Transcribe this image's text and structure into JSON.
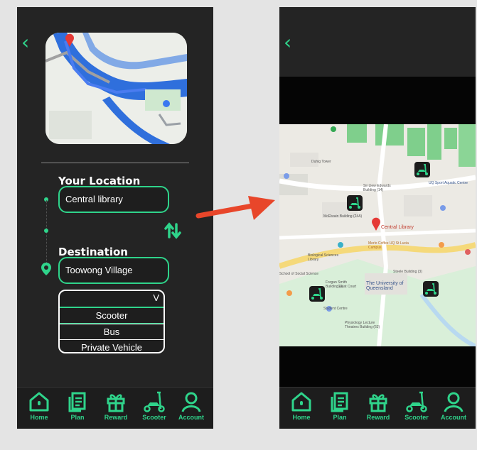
{
  "left_screen": {
    "back_icon": "‹",
    "form": {
      "location_label": "Your Location",
      "location_value": "Central library",
      "destination_label": "Destination",
      "destination_value": "Toowong Village"
    },
    "transport_dropdown": {
      "chevron": "V",
      "options": [
        "Scooter",
        "Bus",
        "Private Vehicle"
      ],
      "selected": "Scooter"
    }
  },
  "right_screen": {
    "back_icon": "‹",
    "map_labels": {
      "central_library": "Central Library",
      "university": "The University of Queensland",
      "sir_llew": "Sir Llew Edwards Building (14)",
      "uq_sport": "UQ Sport Aquatic Centre",
      "student_centre": "Student Centre",
      "great_court": "Great Court",
      "school_science": "School of Social Science",
      "physiology": "Physiology Lecture Theatres Building (63)",
      "biological": "Biological Sciences Library",
      "mcelwain": "McElwain Building (24A)",
      "steele": "Steele Building (3)",
      "forgan": "Forgan Smith Building (1)",
      "duhig": "Duhig Tower",
      "merlo": "Merlo Coffee UQ St Lucia Campus"
    }
  },
  "nav": {
    "items": [
      {
        "label": "Home",
        "icon": "home-icon"
      },
      {
        "label": "Plan",
        "icon": "plan-icon"
      },
      {
        "label": "Reward",
        "icon": "gift-icon"
      },
      {
        "label": "Scooter",
        "icon": "scooter-icon"
      },
      {
        "label": "Account",
        "icon": "account-icon"
      }
    ]
  },
  "colors": {
    "accent": "#2fd48b",
    "background": "#242424",
    "arrow": "#e8462a"
  }
}
